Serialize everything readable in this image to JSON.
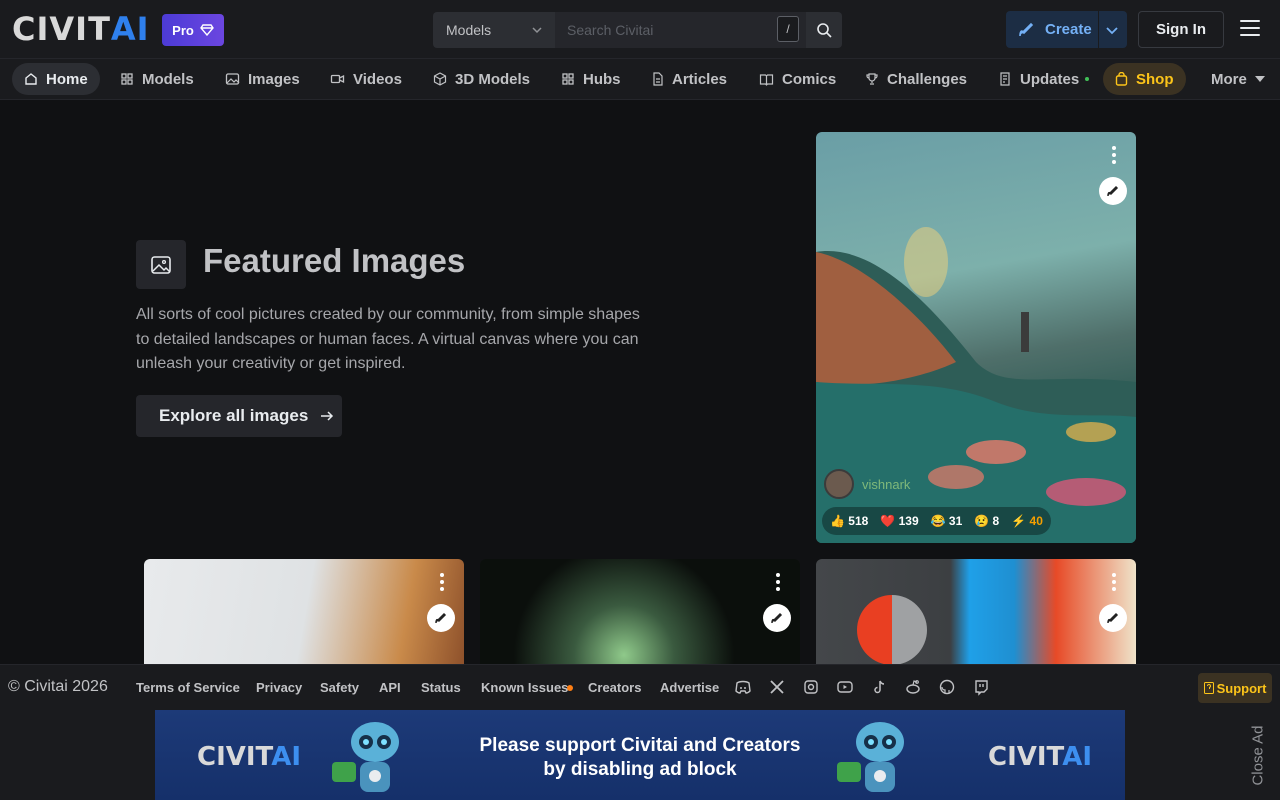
{
  "header": {
    "logo_text": "CIVIT",
    "logo_accent": "AI",
    "pro_label": "Pro",
    "search": {
      "scope": "Models",
      "placeholder": "Search Civitai",
      "shortcut": "/"
    },
    "create_label": "Create",
    "signin_label": "Sign In"
  },
  "nav": {
    "items": [
      {
        "label": "Home",
        "icon": "home-icon"
      },
      {
        "label": "Models",
        "icon": "grid-icon"
      },
      {
        "label": "Images",
        "icon": "photo-icon"
      },
      {
        "label": "Videos",
        "icon": "video-icon"
      },
      {
        "label": "3D Models",
        "icon": "cube-icon"
      },
      {
        "label": "Hubs",
        "icon": "grid-icon"
      },
      {
        "label": "Articles",
        "icon": "file-icon"
      },
      {
        "label": "Comics",
        "icon": "book-icon"
      },
      {
        "label": "Challenges",
        "icon": "trophy-icon"
      },
      {
        "label": "Updates",
        "icon": "updates-icon"
      },
      {
        "label": "Shop",
        "icon": "bag-icon"
      },
      {
        "label": "More",
        "icon": "caret-down-icon"
      }
    ]
  },
  "featured": {
    "title": "Featured Images",
    "description": "All sorts of cool pictures created by our community, from simple shapes to detailed landscapes or human faces. A virtual canvas where you can unleash your creativity or get inspired.",
    "button_label": "Explore all images"
  },
  "cards": {
    "main": {
      "author": "vishnark",
      "reactions": {
        "like": "518",
        "heart": "139",
        "laugh": "31",
        "cry": "8",
        "buzz": "40"
      }
    }
  },
  "footer": {
    "copyright": "© Civitai 2026",
    "links": [
      "Terms of Service",
      "Privacy",
      "Safety",
      "API",
      "Status",
      "Known Issues",
      "Creators",
      "Advertise"
    ],
    "social_icons": [
      "discord-icon",
      "x-icon",
      "instagram-icon",
      "youtube-icon",
      "tiktok-icon",
      "reddit-icon",
      "github-icon",
      "twitch-icon"
    ],
    "support_label": "Support"
  },
  "ad": {
    "line1": "Please support Civitai and Creators",
    "line2": "by disabling ad block",
    "logo_text": "CIVIT",
    "logo_accent": "AI",
    "close_label": "Close Ad"
  },
  "colors": {
    "accent": "#2f80ed",
    "shop": "#fcc419",
    "pro_gradient": "#5b40dd",
    "background": "#101113"
  }
}
